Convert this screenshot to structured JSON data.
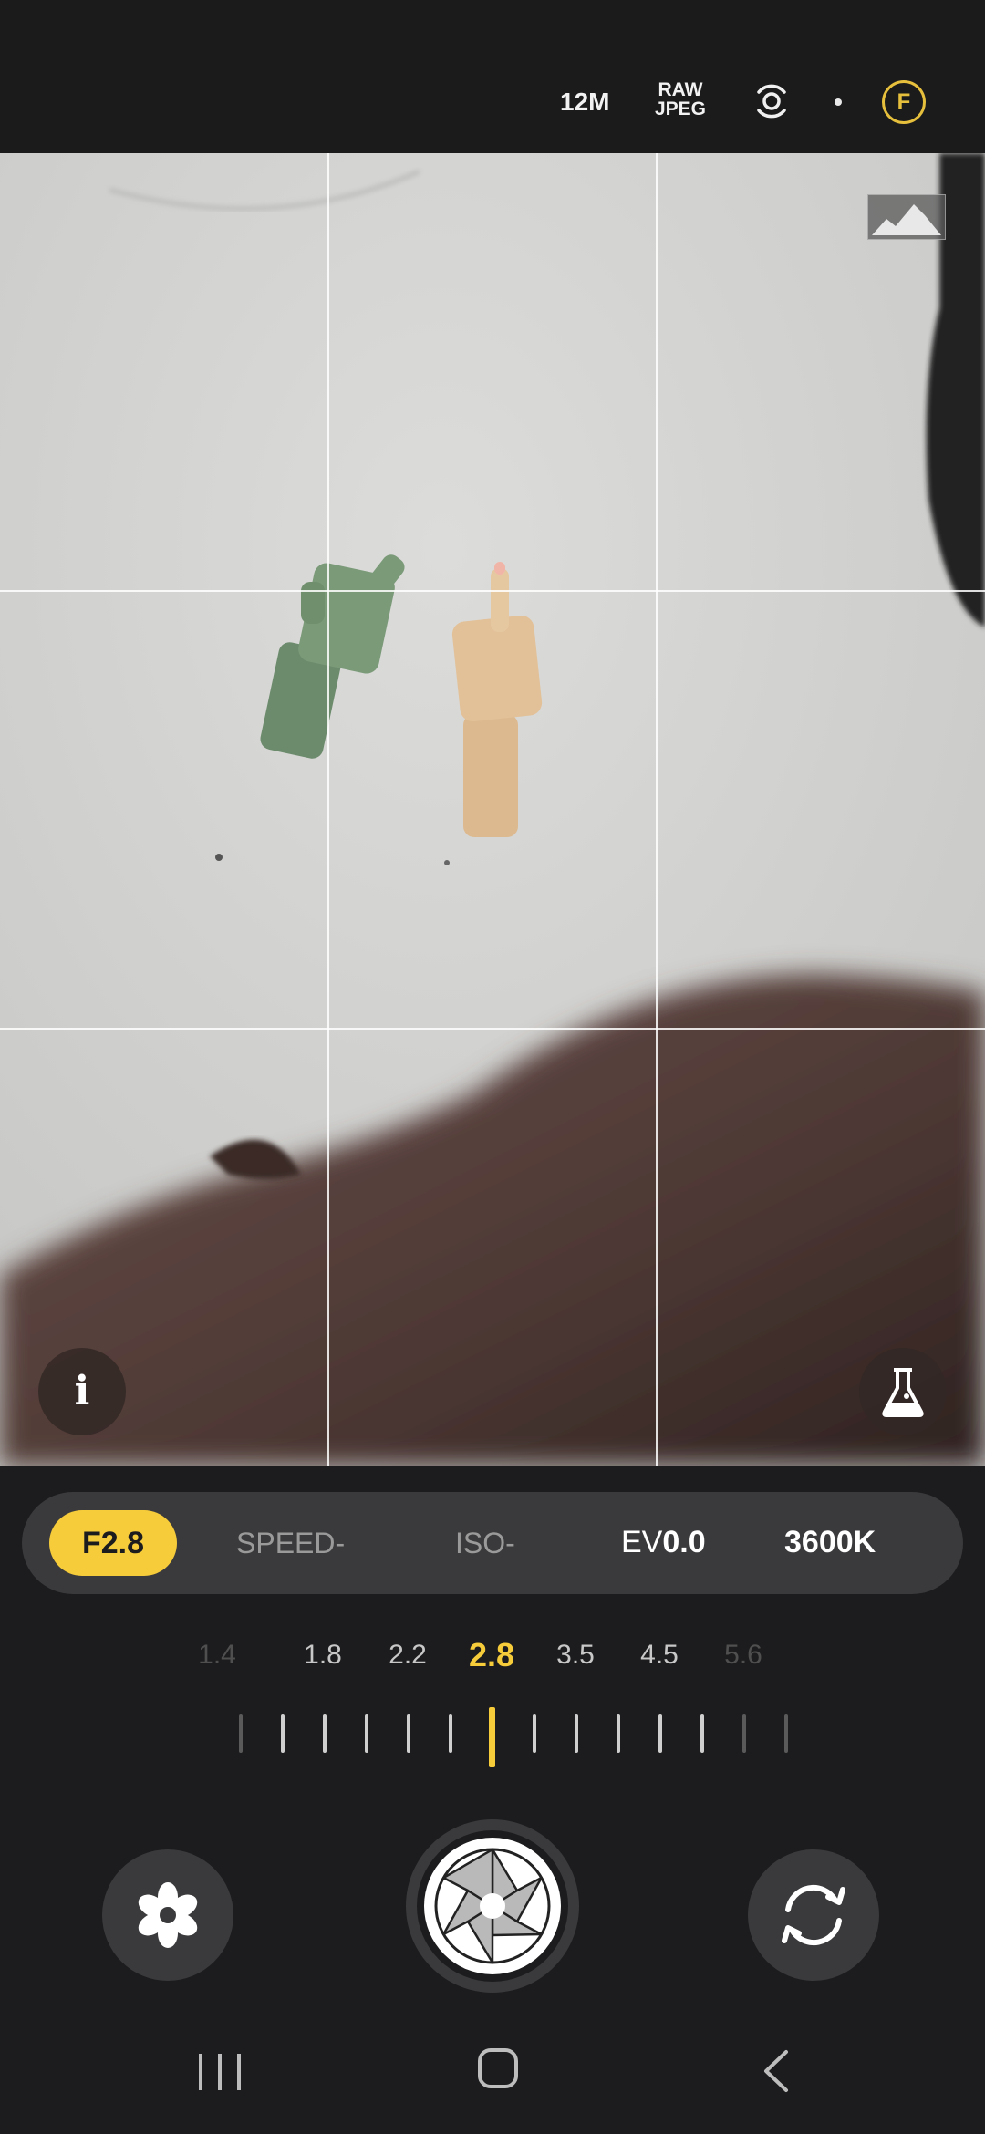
{
  "top_bar": {
    "resolution": "12M",
    "format_line1": "RAW",
    "format_line2": "JPEG",
    "lens_icon": "lens-switch-icon",
    "profile_badge": "F",
    "accent_color": "#e6bf3c"
  },
  "viewfinder": {
    "grid": "3x3",
    "histogram_icon": "histogram-icon",
    "info_label": "i",
    "lab_icon": "flask-icon"
  },
  "controls": {
    "aperture": "F2.8",
    "speed": "SPEED-",
    "iso": "ISO-",
    "ev_label": "EV",
    "ev_value": "0.0",
    "white_balance": "3600K",
    "active_color": "#f7cc3a"
  },
  "aperture_dial": {
    "stops": [
      {
        "label": "1.4",
        "state": "dim"
      },
      {
        "label": "1.8",
        "state": "normal"
      },
      {
        "label": "2.2",
        "state": "normal"
      },
      {
        "label": "2.8",
        "state": "active"
      },
      {
        "label": "3.5",
        "state": "normal"
      },
      {
        "label": "4.5",
        "state": "normal"
      },
      {
        "label": "5.6",
        "state": "dim"
      }
    ],
    "selected": "2.8"
  },
  "bottom": {
    "left_button_icon": "macro-flower-icon",
    "shutter_icon": "shutter-aperture-icon",
    "right_button_icon": "switch-camera-icon"
  },
  "nav": {
    "recent_icon": "recent-apps-icon",
    "home_icon": "home-icon",
    "back_icon": "back-icon"
  }
}
